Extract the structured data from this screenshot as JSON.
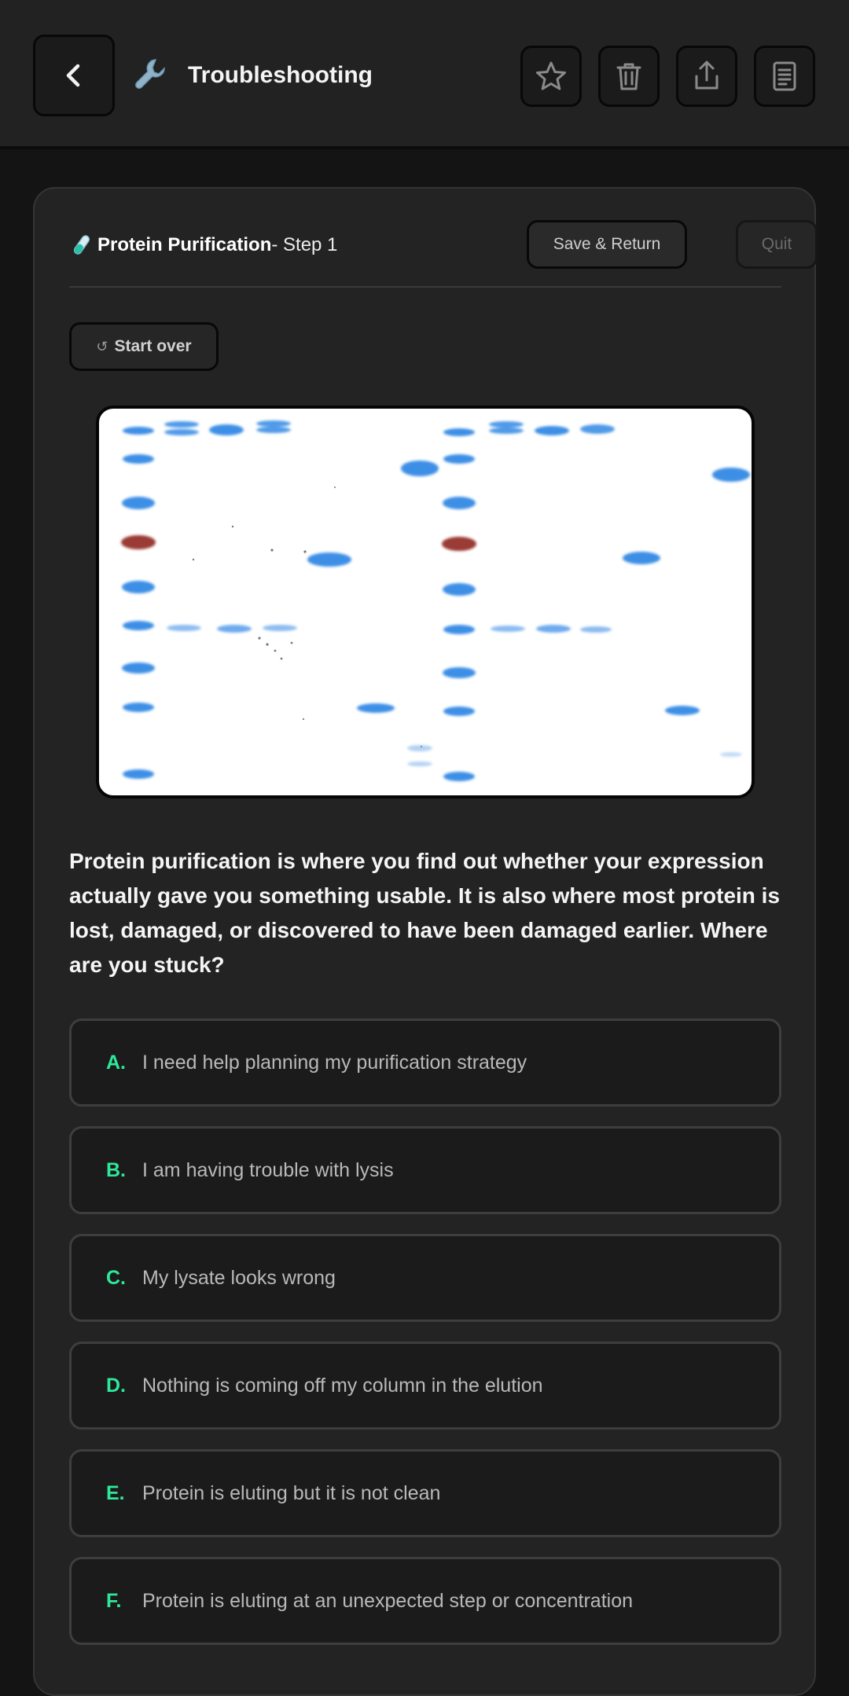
{
  "header": {
    "title": "Troubleshooting",
    "app_icon": "wrench-icon",
    "actions": [
      "star-icon",
      "trash-icon",
      "share-icon",
      "notes-icon"
    ]
  },
  "step": {
    "topic": "Protein Purification",
    "step_label": " - Step 1",
    "save_label": "Save & Return",
    "quit_label": "Quit",
    "start_over_label": "Start over"
  },
  "question": "Protein purification is where you find out whether your expression actually gave you something usable. It is also where most protein is lost, damaged, or discovered to have been damaged earlier. Where are you stuck?",
  "options": [
    {
      "letter": "A.",
      "text": "I need help planning my purification strategy"
    },
    {
      "letter": "B.",
      "text": "I am having trouble with lysis"
    },
    {
      "letter": "C.",
      "text": "My lysate looks wrong"
    },
    {
      "letter": "D.",
      "text": "Nothing is coming off my column in the elution"
    },
    {
      "letter": "E.",
      "text": "Protein is eluting but it is not clean"
    },
    {
      "letter": "F.",
      "text": "Protein is eluting at an unexpected step or concentration"
    }
  ],
  "colors": {
    "accent": "#2ee89a",
    "gel_band": "#3d8fe6",
    "marker_red": "#9a3b34"
  }
}
